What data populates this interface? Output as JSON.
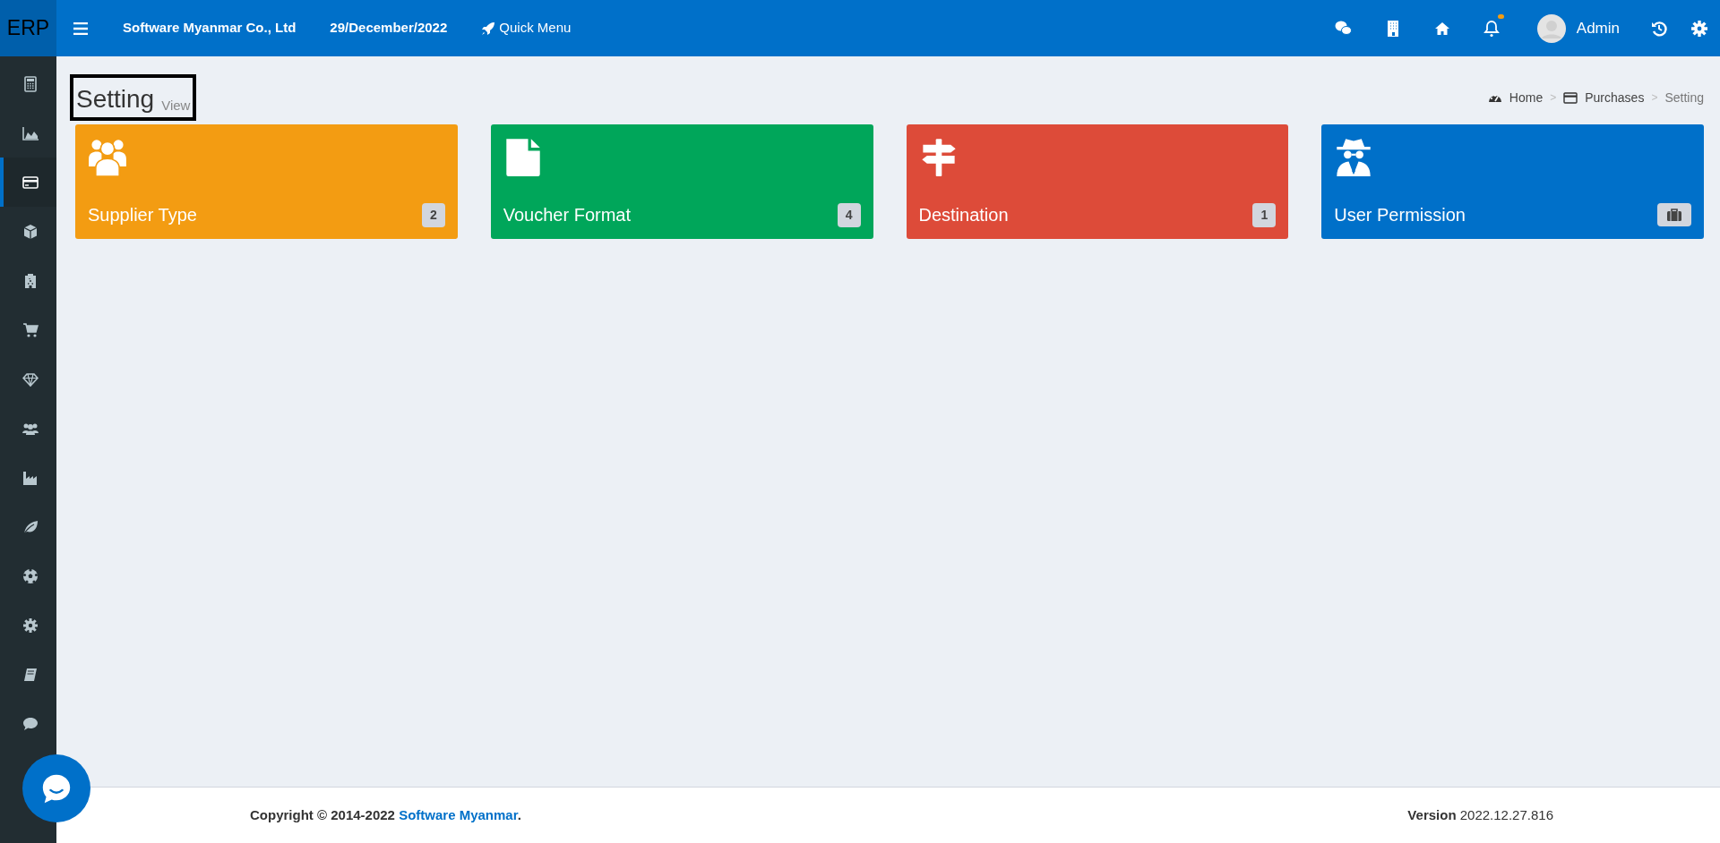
{
  "topbar": {
    "logo": "ERP",
    "company": "Software Myanmar Co., Ltd",
    "date": "29/December/2022",
    "quick_menu": "Quick Menu",
    "notification_dot": true,
    "user": "Admin"
  },
  "sidebar": {
    "items": [
      {
        "selected": false
      },
      {
        "selected": false
      },
      {
        "selected": true
      },
      {
        "selected": false
      },
      {
        "selected": false
      },
      {
        "selected": false
      },
      {
        "selected": false
      },
      {
        "selected": false
      },
      {
        "selected": false
      },
      {
        "selected": false
      },
      {
        "selected": false
      },
      {
        "selected": false
      },
      {
        "selected": false
      },
      {
        "selected": false
      }
    ]
  },
  "page": {
    "title": "Setting",
    "subtitle": "View"
  },
  "breadcrumb": {
    "items": [
      "Home",
      "Purchases",
      "Setting"
    ],
    "separators": [
      ">",
      ">"
    ]
  },
  "cards": [
    {
      "title": "Supplier Type",
      "color": "#f39c12",
      "kind": "count",
      "badge": "2"
    },
    {
      "title": "Voucher Format",
      "color": "#00a65a",
      "kind": "count",
      "badge": "4"
    },
    {
      "title": "Destination",
      "color": "#dd4b39",
      "kind": "count",
      "badge": "1"
    },
    {
      "title": "User Permission",
      "color": "#0070c9",
      "kind": "icon"
    }
  ],
  "footer": {
    "copyright": "Copyright © 2014-2022",
    "link": "Software Myanmar",
    "end": ".",
    "version": "**Version** 2022.12.27.816"
  }
}
